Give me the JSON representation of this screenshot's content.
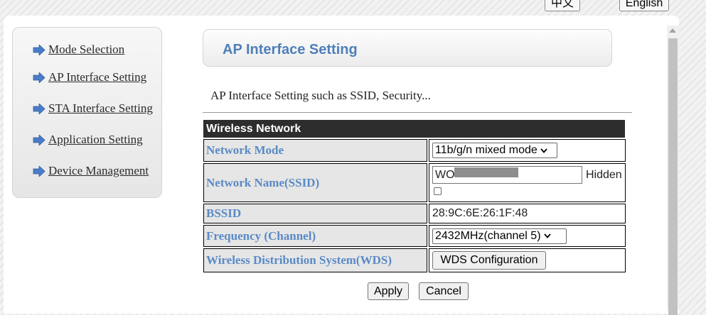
{
  "language": {
    "chinese": "中文",
    "english": "English"
  },
  "sidebar": {
    "items": [
      {
        "label": "Mode Selection",
        "icon": "arrow-right-icon"
      },
      {
        "label": "AP Interface Setting",
        "icon": "arrow-right-icon"
      },
      {
        "label": "STA Interface Setting",
        "icon": "arrow-right-icon"
      },
      {
        "label": "Application Setting",
        "icon": "arrow-right-icon"
      },
      {
        "label": "Device Management",
        "icon": "arrow-right-icon"
      }
    ]
  },
  "page": {
    "title": "AP Interface Setting",
    "description": "AP Interface Setting such as SSID, Security..."
  },
  "table": {
    "header": "Wireless Network",
    "rows": {
      "network_mode": {
        "label": "Network Mode",
        "value": "11b/g/n mixed mode"
      },
      "ssid": {
        "label": "Network Name(SSID)",
        "value": "WO",
        "hidden_label": "Hidden",
        "hidden_checked": false
      },
      "bssid": {
        "label": "BSSID",
        "value": "28:9C:6E:26:1F:48"
      },
      "frequency": {
        "label": "Frequency (Channel)",
        "value": "2432MHz(channel 5)"
      },
      "wds": {
        "label": "Wireless Distribution System(WDS)",
        "button": "WDS Configuration"
      }
    }
  },
  "actions": {
    "apply": "Apply",
    "cancel": "Cancel"
  },
  "colors": {
    "accent": "#5a8ac6",
    "title": "#4f7fb9",
    "header_bg": "#2d2d2d",
    "arrow": "#4a7dc8"
  }
}
